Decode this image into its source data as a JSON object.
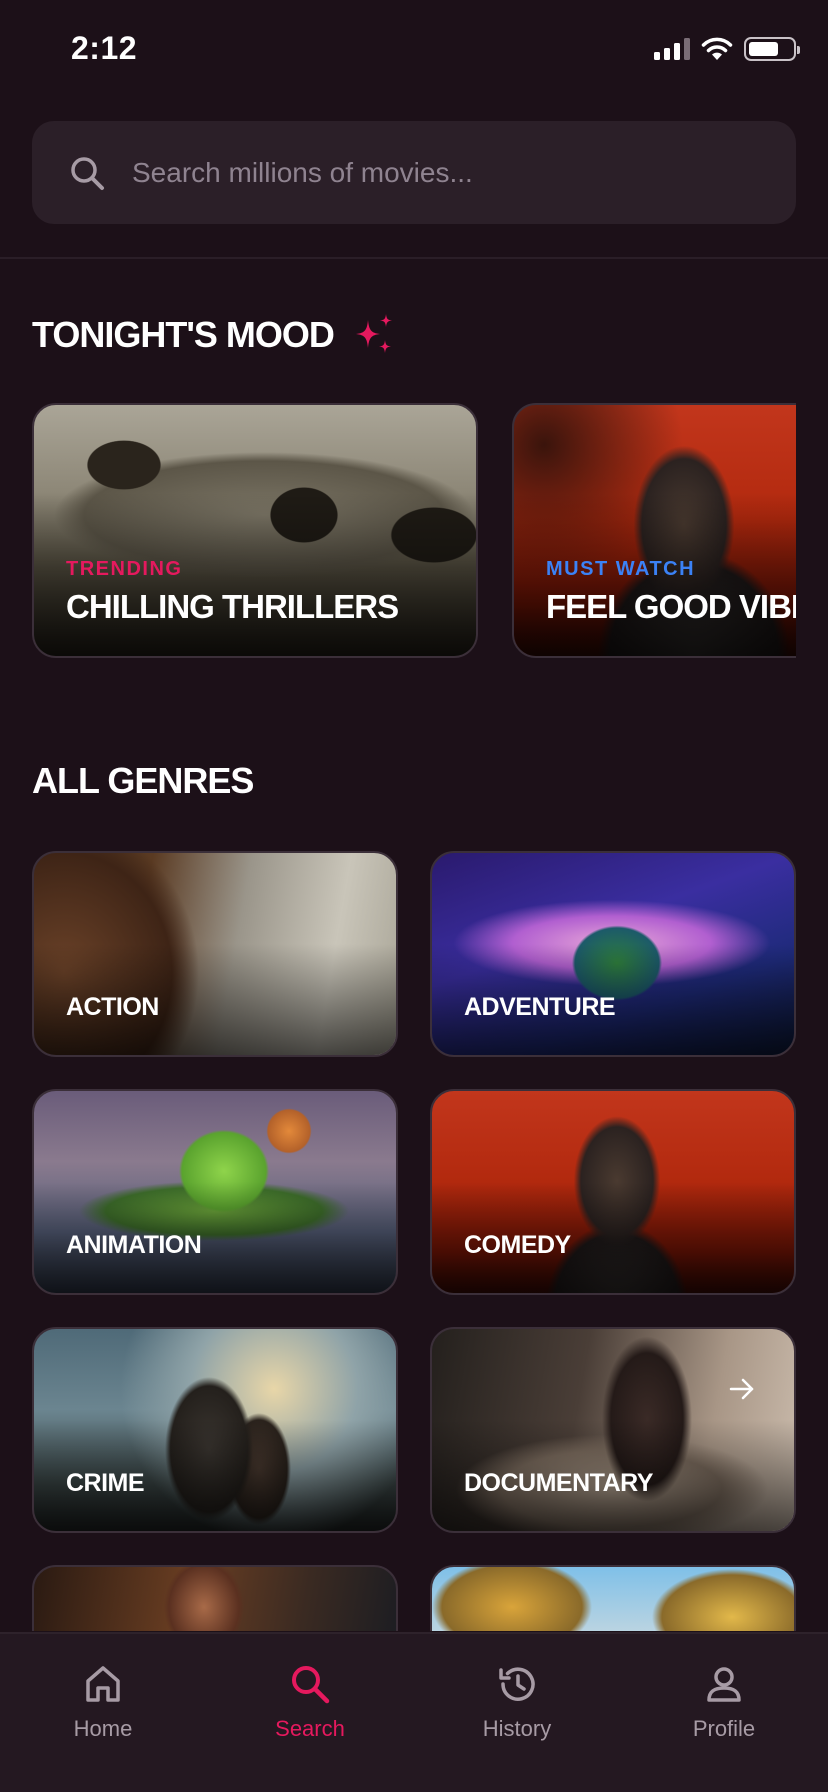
{
  "status_bar": {
    "time": "2:12"
  },
  "search": {
    "placeholder": "Search millions of movies..."
  },
  "mood_section": {
    "title": "TONIGHT'S MOOD",
    "cards": [
      {
        "tag": "TRENDING",
        "tag_color": "#e5195e",
        "title": "CHILLING THRILLERS"
      },
      {
        "tag": "MUST WATCH",
        "tag_color": "#3b82f6",
        "title": "FEEL GOOD VIBES"
      }
    ]
  },
  "genres_section": {
    "title": "ALL GENRES",
    "items": [
      {
        "label": "ACTION"
      },
      {
        "label": "ADVENTURE"
      },
      {
        "label": "ANIMATION"
      },
      {
        "label": "COMEDY"
      },
      {
        "label": "CRIME"
      },
      {
        "label": "DOCUMENTARY"
      },
      {
        "label": ""
      },
      {
        "label": ""
      }
    ]
  },
  "tab_bar": {
    "items": [
      {
        "label": "Home",
        "icon": "home-icon"
      },
      {
        "label": "Search",
        "icon": "search-icon",
        "active": true
      },
      {
        "label": "History",
        "icon": "history-icon"
      },
      {
        "label": "Profile",
        "icon": "profile-icon"
      }
    ]
  },
  "colors": {
    "accent": "#e5195e",
    "background": "#1c1018",
    "must_watch": "#3b82f6"
  }
}
